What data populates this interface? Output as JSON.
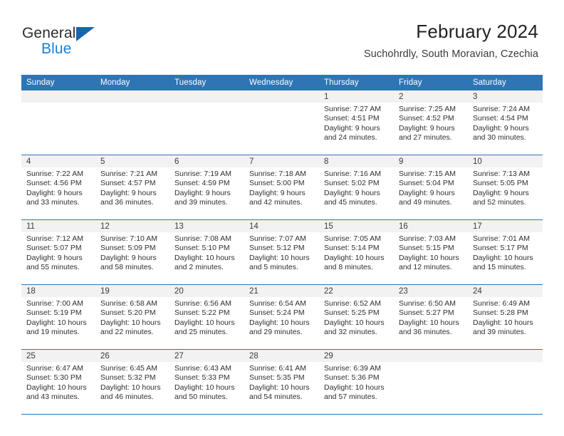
{
  "brand": {
    "word_one": "General",
    "word_two": "Blue",
    "triangle_color": "#1566b0",
    "blue_text_color": "#1f7fd0"
  },
  "header": {
    "title": "February 2024",
    "subtitle": "Suchohrdly, South Moravian, Czechia"
  },
  "theme": {
    "header_blue": "#2e75b6",
    "daynum_band": "#f2f2f2",
    "text": "#2f2f2f"
  },
  "calendar": {
    "weekday_headers": [
      "Sunday",
      "Monday",
      "Tuesday",
      "Wednesday",
      "Thursday",
      "Friday",
      "Saturday"
    ],
    "weeks": [
      [
        {
          "day": "",
          "lines": []
        },
        {
          "day": "",
          "lines": []
        },
        {
          "day": "",
          "lines": []
        },
        {
          "day": "",
          "lines": []
        },
        {
          "day": "1",
          "lines": [
            "Sunrise: 7:27 AM",
            "Sunset: 4:51 PM",
            "Daylight: 9 hours",
            "and 24 minutes."
          ]
        },
        {
          "day": "2",
          "lines": [
            "Sunrise: 7:25 AM",
            "Sunset: 4:52 PM",
            "Daylight: 9 hours",
            "and 27 minutes."
          ]
        },
        {
          "day": "3",
          "lines": [
            "Sunrise: 7:24 AM",
            "Sunset: 4:54 PM",
            "Daylight: 9 hours",
            "and 30 minutes."
          ]
        }
      ],
      [
        {
          "day": "4",
          "lines": [
            "Sunrise: 7:22 AM",
            "Sunset: 4:56 PM",
            "Daylight: 9 hours",
            "and 33 minutes."
          ]
        },
        {
          "day": "5",
          "lines": [
            "Sunrise: 7:21 AM",
            "Sunset: 4:57 PM",
            "Daylight: 9 hours",
            "and 36 minutes."
          ]
        },
        {
          "day": "6",
          "lines": [
            "Sunrise: 7:19 AM",
            "Sunset: 4:59 PM",
            "Daylight: 9 hours",
            "and 39 minutes."
          ]
        },
        {
          "day": "7",
          "lines": [
            "Sunrise: 7:18 AM",
            "Sunset: 5:00 PM",
            "Daylight: 9 hours",
            "and 42 minutes."
          ]
        },
        {
          "day": "8",
          "lines": [
            "Sunrise: 7:16 AM",
            "Sunset: 5:02 PM",
            "Daylight: 9 hours",
            "and 45 minutes."
          ]
        },
        {
          "day": "9",
          "lines": [
            "Sunrise: 7:15 AM",
            "Sunset: 5:04 PM",
            "Daylight: 9 hours",
            "and 49 minutes."
          ]
        },
        {
          "day": "10",
          "lines": [
            "Sunrise: 7:13 AM",
            "Sunset: 5:05 PM",
            "Daylight: 9 hours",
            "and 52 minutes."
          ]
        }
      ],
      [
        {
          "day": "11",
          "lines": [
            "Sunrise: 7:12 AM",
            "Sunset: 5:07 PM",
            "Daylight: 9 hours",
            "and 55 minutes."
          ]
        },
        {
          "day": "12",
          "lines": [
            "Sunrise: 7:10 AM",
            "Sunset: 5:09 PM",
            "Daylight: 9 hours",
            "and 58 minutes."
          ]
        },
        {
          "day": "13",
          "lines": [
            "Sunrise: 7:08 AM",
            "Sunset: 5:10 PM",
            "Daylight: 10 hours",
            "and 2 minutes."
          ]
        },
        {
          "day": "14",
          "lines": [
            "Sunrise: 7:07 AM",
            "Sunset: 5:12 PM",
            "Daylight: 10 hours",
            "and 5 minutes."
          ]
        },
        {
          "day": "15",
          "lines": [
            "Sunrise: 7:05 AM",
            "Sunset: 5:14 PM",
            "Daylight: 10 hours",
            "and 8 minutes."
          ]
        },
        {
          "day": "16",
          "lines": [
            "Sunrise: 7:03 AM",
            "Sunset: 5:15 PM",
            "Daylight: 10 hours",
            "and 12 minutes."
          ]
        },
        {
          "day": "17",
          "lines": [
            "Sunrise: 7:01 AM",
            "Sunset: 5:17 PM",
            "Daylight: 10 hours",
            "and 15 minutes."
          ]
        }
      ],
      [
        {
          "day": "18",
          "lines": [
            "Sunrise: 7:00 AM",
            "Sunset: 5:19 PM",
            "Daylight: 10 hours",
            "and 19 minutes."
          ]
        },
        {
          "day": "19",
          "lines": [
            "Sunrise: 6:58 AM",
            "Sunset: 5:20 PM",
            "Daylight: 10 hours",
            "and 22 minutes."
          ]
        },
        {
          "day": "20",
          "lines": [
            "Sunrise: 6:56 AM",
            "Sunset: 5:22 PM",
            "Daylight: 10 hours",
            "and 25 minutes."
          ]
        },
        {
          "day": "21",
          "lines": [
            "Sunrise: 6:54 AM",
            "Sunset: 5:24 PM",
            "Daylight: 10 hours",
            "and 29 minutes."
          ]
        },
        {
          "day": "22",
          "lines": [
            "Sunrise: 6:52 AM",
            "Sunset: 5:25 PM",
            "Daylight: 10 hours",
            "and 32 minutes."
          ]
        },
        {
          "day": "23",
          "lines": [
            "Sunrise: 6:50 AM",
            "Sunset: 5:27 PM",
            "Daylight: 10 hours",
            "and 36 minutes."
          ]
        },
        {
          "day": "24",
          "lines": [
            "Sunrise: 6:49 AM",
            "Sunset: 5:28 PM",
            "Daylight: 10 hours",
            "and 39 minutes."
          ]
        }
      ],
      [
        {
          "day": "25",
          "lines": [
            "Sunrise: 6:47 AM",
            "Sunset: 5:30 PM",
            "Daylight: 10 hours",
            "and 43 minutes."
          ]
        },
        {
          "day": "26",
          "lines": [
            "Sunrise: 6:45 AM",
            "Sunset: 5:32 PM",
            "Daylight: 10 hours",
            "and 46 minutes."
          ]
        },
        {
          "day": "27",
          "lines": [
            "Sunrise: 6:43 AM",
            "Sunset: 5:33 PM",
            "Daylight: 10 hours",
            "and 50 minutes."
          ]
        },
        {
          "day": "28",
          "lines": [
            "Sunrise: 6:41 AM",
            "Sunset: 5:35 PM",
            "Daylight: 10 hours",
            "and 54 minutes."
          ]
        },
        {
          "day": "29",
          "lines": [
            "Sunrise: 6:39 AM",
            "Sunset: 5:36 PM",
            "Daylight: 10 hours",
            "and 57 minutes."
          ]
        },
        {
          "day": "",
          "lines": []
        },
        {
          "day": "",
          "lines": []
        }
      ]
    ]
  }
}
